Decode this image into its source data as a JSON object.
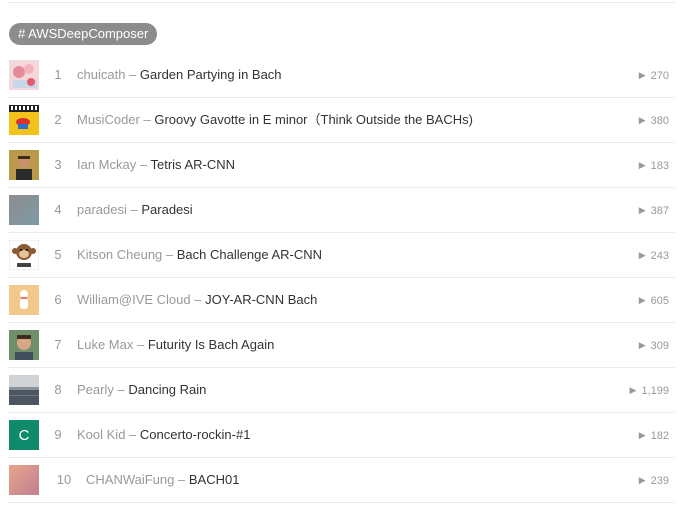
{
  "tag": {
    "label": "# AWSDeepComposer"
  },
  "tracks": [
    {
      "rank": "1",
      "user": "chuicath",
      "separator": "–",
      "title": "Garden Partying in Bach",
      "plays": "270",
      "art": "flower-icon"
    },
    {
      "rank": "2",
      "user": "MusiCoder",
      "separator": "–",
      "title": "Groovy Gavotte in E minor（Think Outside the BACHs)",
      "plays": "380",
      "art": "keyboard-icon"
    },
    {
      "rank": "3",
      "user": "Ian Mckay",
      "separator": "–",
      "title": "Tetris AR-CNN",
      "plays": "183",
      "art": "portrait-icon"
    },
    {
      "rank": "4",
      "user": "paradesi",
      "separator": "–",
      "title": "Paradesi",
      "plays": "387",
      "art": "gradient-art"
    },
    {
      "rank": "5",
      "user": "Kitson Cheung",
      "separator": "–",
      "title": "Bach Challenge AR-CNN",
      "plays": "243",
      "art": "monkey-icon"
    },
    {
      "rank": "6",
      "user": "William@IVE Cloud",
      "separator": "–",
      "title": "JOY-AR-CNN Bach",
      "plays": "605",
      "art": "figure-icon"
    },
    {
      "rank": "7",
      "user": "Luke Max",
      "separator": "–",
      "title": "Futurity Is Bach Again",
      "plays": "309",
      "art": "portrait-icon"
    },
    {
      "rank": "8",
      "user": "Pearly",
      "separator": "–",
      "title": "Dancing Rain",
      "plays": "1,199",
      "art": "landscape-art"
    },
    {
      "rank": "9",
      "user": "Kool Kid",
      "separator": "–",
      "title": "Concerto-rockin-#1",
      "plays": "182",
      "art": "letter-avatar",
      "avatar_letter": "C"
    },
    {
      "rank": "10",
      "user": "CHANWaiFung",
      "separator": "–",
      "title": "BACH01",
      "plays": "239",
      "art": "gradient-art"
    }
  ],
  "icons": {
    "play": "play-icon"
  },
  "colors": {
    "tag_bg": "#8c8c8c",
    "muted_text": "#999999",
    "track_text": "#333333",
    "avatar_teal": "#0f8a6a"
  }
}
